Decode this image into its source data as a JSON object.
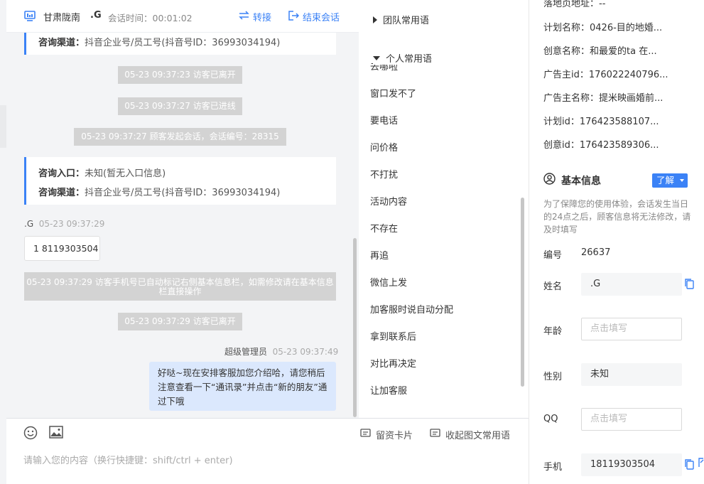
{
  "header": {
    "visitor_region": "甘肃陇南",
    "visitor_name": ".G",
    "session_time": "会话时间：00:01:02",
    "transfer_label": "转接",
    "end_label": "结束会话"
  },
  "chat": {
    "card_top": {
      "channel_label": "咨询渠道：",
      "channel_value": "抖音企业号/员工号(抖音号ID：36993034194)"
    },
    "sys1": "05-23 09:37:23 访客已离开",
    "sys2": "05-23 09:37:27 访客已进线",
    "sys3": "05-23 09:37:27 顾客发起会话，会话编号：28315",
    "card2": {
      "entry_label": "咨询入口：",
      "entry_value": "未知(暂无入口信息)",
      "channel_label": "咨询渠道：",
      "channel_value": "抖音企业号/员工号(抖音号ID：36993034194)"
    },
    "visitor_msg": {
      "name": ".G",
      "time": "05-23 09:37:29",
      "text": "1 8119303504"
    },
    "sys4": "05-23 09:37:29 访客手机号已自动标记右侧基本信息栏，如需修改请在基本信息栏直接操作",
    "sys5": "05-23 09:37:29 访客已离开",
    "agent_msg": {
      "name": "超级管理员",
      "time": "05-23 09:37:49",
      "text": "好哒~现在安排客服加您介绍哈，请您稍后注意查看一下“通讯录”并点击“新的朋友”通过下哦"
    },
    "input_placeholder": "请输入您的内容（换行快捷键：shift/ctrl + enter)"
  },
  "phrases": {
    "team_group": "团队常用语",
    "personal_group": "个人常用语",
    "items": [
      "去哪啦",
      "窗口发不了",
      "要电话",
      "问价格",
      "不打扰",
      "活动内容",
      "不存在",
      "再追",
      "微信上发",
      "加客服时说自动分配",
      "拿到联系后",
      "对比再决定",
      "让加客服"
    ],
    "footer": {
      "card_label": "留资卡片",
      "collapse_label": "收起图文常用语"
    }
  },
  "info": {
    "ad_fields": [
      "落地页地址：--",
      "计划名称：0426-目的地婚...",
      "创意名称：和最爱的ta 在...",
      "广告主id：176022240796...",
      "广告主名称：提米映画婚前...",
      "计划id：176423588107...",
      "创意id：176423589306..."
    ],
    "section_title": "基本信息",
    "learn_label": "了解",
    "hint": "为了保障您的使用体验，会话发生当日的24点之后，顾客信息将无法修改，请及时填写",
    "id_label": "编号",
    "id_value": "26637",
    "name_label": "姓名",
    "name_value": ".G",
    "age_label": "年龄",
    "age_placeholder": "点击填写",
    "gender_label": "性别",
    "gender_value": "未知",
    "qq_label": "QQ",
    "qq_placeholder": "点击填写",
    "phone_label": "手机",
    "phone_value": "18119303504"
  },
  "colors": {
    "accent": "#3b82f6",
    "system_msg": "#d3d3d3",
    "agent_bubble": "#dbe8fd"
  }
}
